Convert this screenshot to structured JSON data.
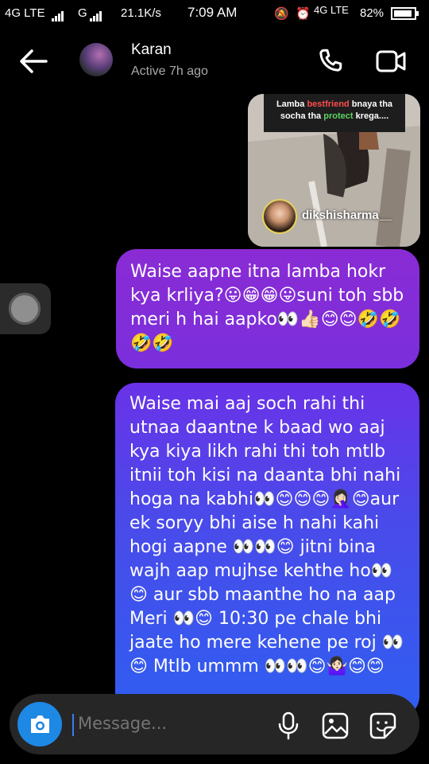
{
  "status_bar": {
    "network1": "4G LTE",
    "network2": "G",
    "speed": "21.1K/s",
    "time": "7:09 AM",
    "network3": "4G LTE",
    "battery": "82%"
  },
  "header": {
    "name": "Karan",
    "status": "Active 7h ago"
  },
  "shared_post": {
    "caption_part1": "Lamba ",
    "caption_red": "bestfriend",
    "caption_part2": " bnaya tha socha tha ",
    "caption_green": "protect",
    "caption_part3": " krega....",
    "handle": "dikshisharma__"
  },
  "messages": [
    {
      "text": "Waise aapne itna lamba hokr kya krliya?😛😁😁😛suni toh sbb meri h hai aapko👀👍🏻😊😊🤣🤣🤣🤣"
    },
    {
      "text": "Waise mai aaj soch rahi thi utnaa daantne k baad wo aaj kya kiya likh rahi thi toh mtlb itnii toh kisi na daanta bhi nahi hoga na kabhi👀😊😊😊🤦🏻‍♀️😊aur ek soryy bhi aise h nahi kahi hogi aapne 👀👀😊 jitni bina wajh aap mujhse kehthe ho👀😊 aur sbb maanthe ho na aap Meri 👀😊 10:30 pe chale bhi jaate ho mere kehene pe roj 👀😊 Mtlb ummm 👀👀😊🤷🏻‍♀️😊😊"
    }
  ],
  "composer": {
    "placeholder": "Message..."
  },
  "colors": {
    "bubble_purple": "#8a2bd4",
    "bubble_blue": "#2f5ef0",
    "camera_button": "#1e88e5"
  }
}
